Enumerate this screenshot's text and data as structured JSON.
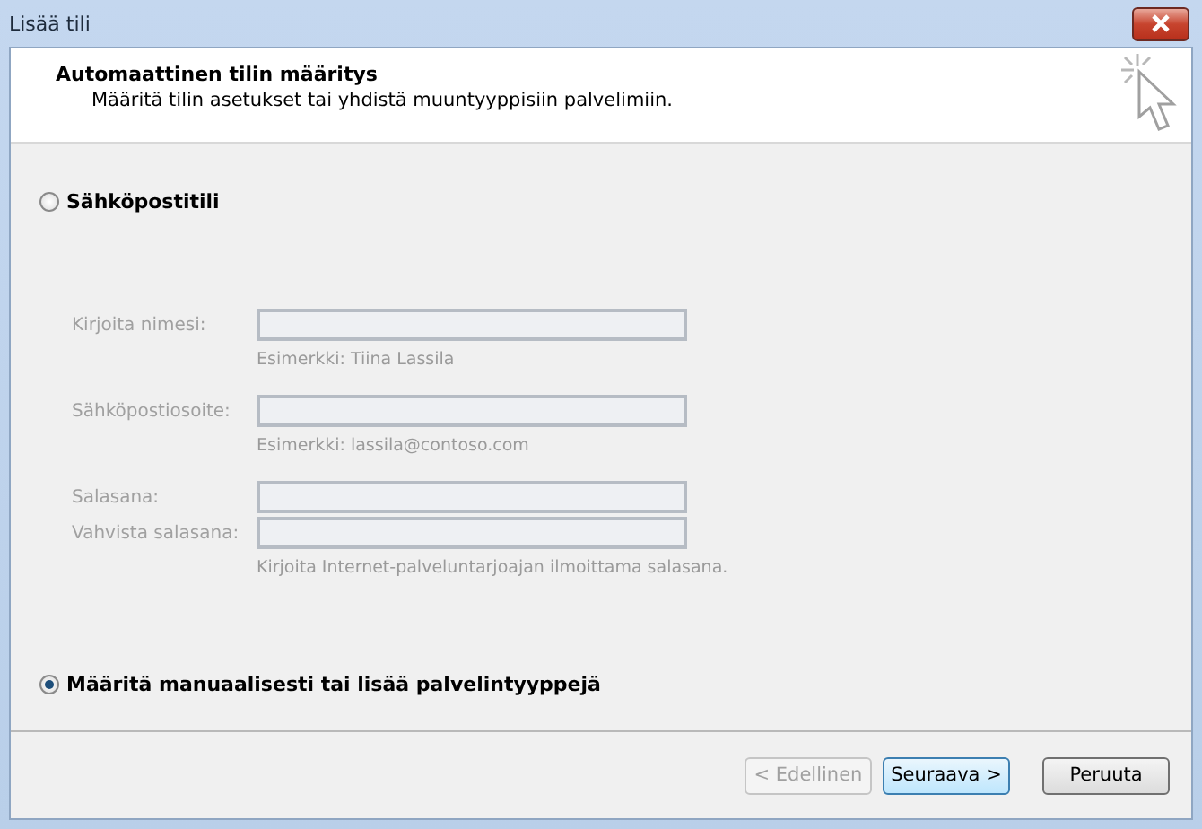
{
  "window": {
    "title": "Lisää tili"
  },
  "header": {
    "title": "Automaattinen tilin määritys",
    "subtitle": "Määritä tilin asetukset tai yhdistä muuntyyppisiin palvelimiin."
  },
  "options": [
    {
      "label": "Sähköpostitili",
      "selected": false
    },
    {
      "label": "Määritä manuaalisesti tai lisää palvelintyyppejä",
      "selected": true
    }
  ],
  "fields": [
    {
      "label": "Kirjoita nimesi:",
      "disabled": true,
      "hint": "Esimerkki: Tiina Lassila"
    },
    {
      "label": "Sähköpostiosoite:",
      "disabled": true,
      "hint": "Esimerkki: lassila@contoso.com"
    },
    {
      "label": "Salasana:",
      "disabled": true
    },
    {
      "label": "Vahvista salasana:",
      "disabled": true,
      "hint": "Kirjoita Internet-palveluntarjoajan ilmoittama salasana."
    }
  ],
  "buttons": [
    {
      "label": "< Edellinen",
      "disabled": true,
      "default": false
    },
    {
      "label": "Seuraava >",
      "disabled": false,
      "default": true
    },
    {
      "label": "Peruuta",
      "disabled": false,
      "default": false
    }
  ]
}
